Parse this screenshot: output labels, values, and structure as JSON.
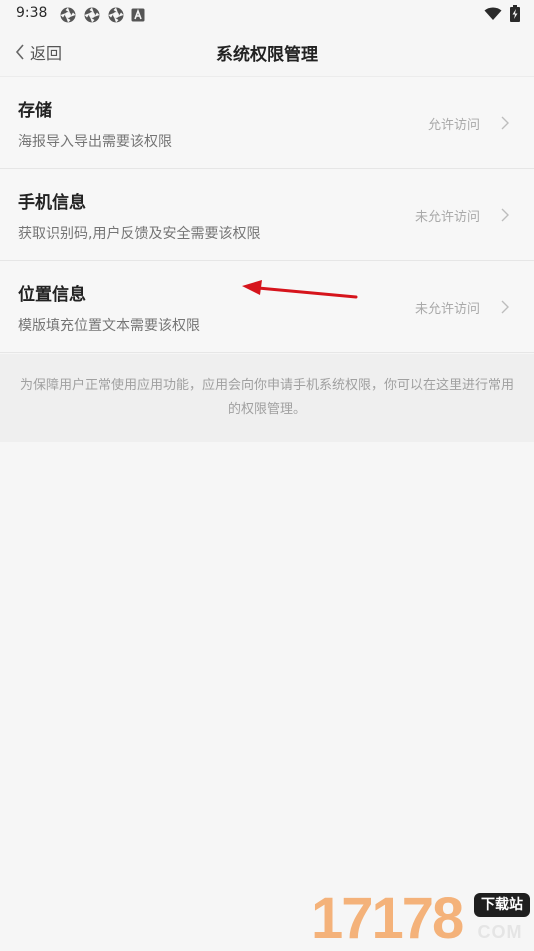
{
  "status_bar": {
    "time": "9:38",
    "icons": [
      "aperture-icon",
      "aperture-icon",
      "aperture-icon",
      "a-icon",
      "wifi-icon",
      "battery-charging-icon"
    ]
  },
  "header": {
    "back_label": "返回",
    "title": "系统权限管理"
  },
  "permissions": [
    {
      "title": "存储",
      "description": "海报导入导出需要该权限",
      "status": "允许访问"
    },
    {
      "title": "手机信息",
      "description": "获取识别码,用户反馈及安全需要该权限",
      "status": "未允许访问"
    },
    {
      "title": "位置信息",
      "description": "模版填充位置文本需要该权限",
      "status": "未允许访问"
    }
  ],
  "footer": {
    "note": "为保障用户正常使用应用功能，应用会向你申请手机系统权限，你可以在这里进行常用的权限管理。"
  },
  "watermark": {
    "number": "17178",
    "tag": "下载站",
    "suffix": "COM"
  },
  "colors": {
    "background": "#f6f6f6",
    "text_primary": "#222222",
    "text_secondary": "#757575",
    "status_text": "#a9a9a9",
    "annotation": "#d6141c"
  }
}
